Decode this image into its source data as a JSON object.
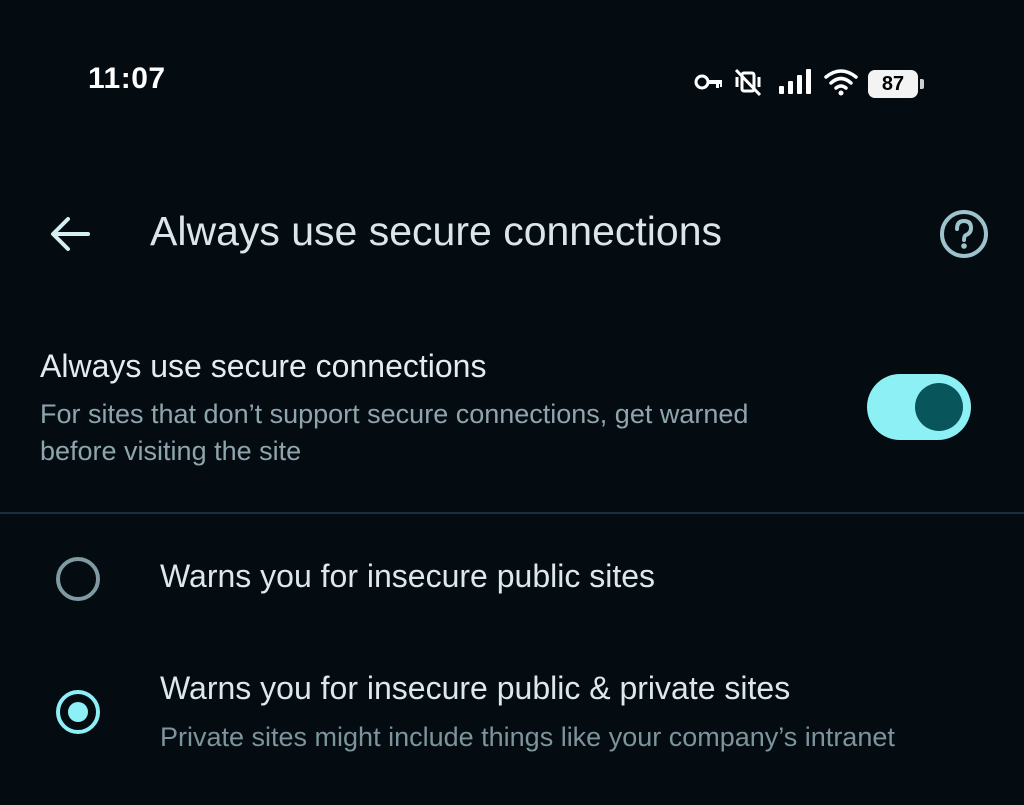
{
  "status_bar": {
    "time": "11:07",
    "battery": "87",
    "icons": [
      "vpn-key-icon",
      "vibrate-off-icon",
      "signal-icon",
      "wifi-icon",
      "battery-icon"
    ]
  },
  "app_bar": {
    "title": "Always use secure connections",
    "back_icon": "arrow-left-icon",
    "help_icon": "help-circle-icon"
  },
  "setting": {
    "title": "Always use secure connections",
    "description": "For sites that don’t support secure connections, get warned before visiting the site",
    "enabled": true
  },
  "options": [
    {
      "label": "Warns you for insecure public sites",
      "description": "",
      "selected": false
    },
    {
      "label": "Warns you for insecure public & private sites",
      "description": "Private sites might include things like your company’s intranet",
      "selected": true
    }
  ],
  "colors": {
    "background": "#040b11",
    "accent": "#8ef0f7",
    "toggle_knob": "#08565c",
    "secondary_text": "#8fa5ad"
  }
}
